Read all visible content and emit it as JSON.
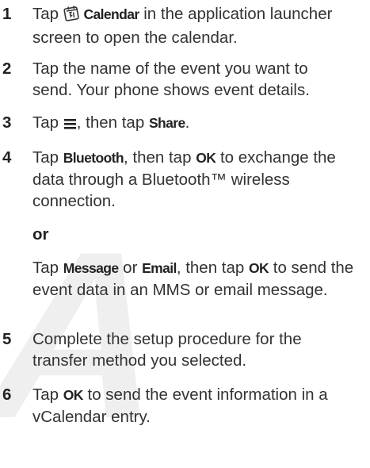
{
  "watermark": "A",
  "steps": [
    {
      "num": "1",
      "a": "Tap ",
      "b": "Calendar",
      "c": " in the application launcher",
      "line2": "screen to open the calendar."
    },
    {
      "num": "2",
      "line1": "Tap the name of the event you want to",
      "line2": "send. Your phone shows event details."
    },
    {
      "num": "3",
      "a": "Tap ",
      "b": ", then tap ",
      "c": "Share",
      "d": "."
    },
    {
      "num": "4",
      "a": "Tap ",
      "b": "Bluetooth",
      "c": ", then tap ",
      "d": "OK",
      "e": " to exchange the",
      "line2": "data through a Bluetooth™ wireless",
      "line3": "connection.",
      "or": "or",
      "alt_a": "Tap ",
      "alt_b": "Message",
      "alt_c": " or ",
      "alt_d": "Email",
      "alt_e": ", then tap ",
      "alt_f": "OK",
      "alt_g": " to send the",
      "alt_line2": "event data in an MMS or email message."
    },
    {
      "num": "5",
      "line1": "Complete the setup procedure for the",
      "line2": "transfer method you selected."
    },
    {
      "num": "6",
      "a": "Tap ",
      "b": "OK",
      "c": " to send the event information in a",
      "line2": "vCalendar entry."
    }
  ],
  "icons": {
    "calendar": "calendar-icon",
    "menu": "menu-icon"
  }
}
